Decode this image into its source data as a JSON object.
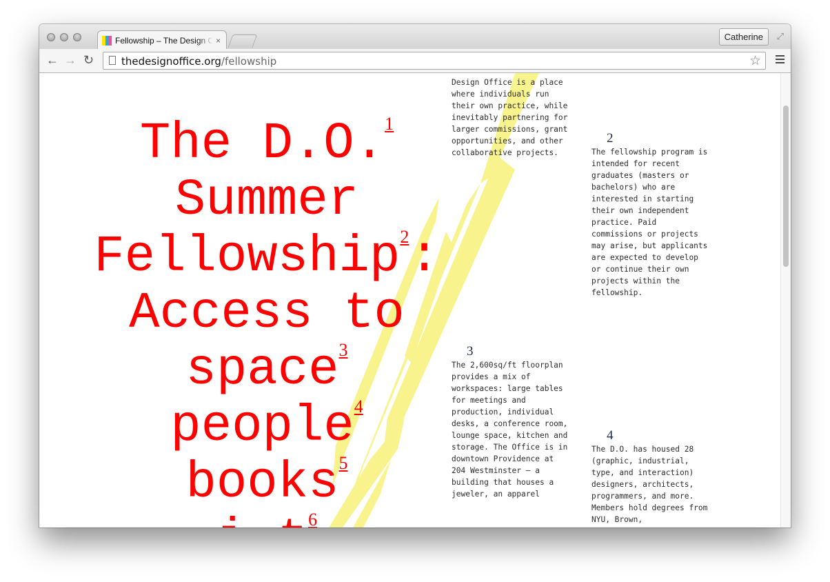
{
  "browser": {
    "tab_title": "Fellowship – The Design Office",
    "tab_close_glyph": "×",
    "profile_name": "Catherine",
    "url_host": "thedesignoffice.org",
    "url_path": "/fellowship",
    "favicon_colors": [
      "#ffe600",
      "#2aa8e0",
      "#f04e9a"
    ]
  },
  "page": {
    "headline": {
      "lines": [
        {
          "text": "The D.O.",
          "fn": "1",
          "after": ""
        },
        {
          "text": "Summer",
          "fn": "",
          "after": ""
        },
        {
          "text": "Fellowship",
          "fn": "2",
          "after": ":"
        },
        {
          "text": "Access to",
          "fn": "",
          "after": ""
        },
        {
          "text": "space",
          "fn": "3",
          "after": ""
        },
        {
          "text": "people",
          "fn": "4",
          "after": ""
        },
        {
          "text": "books",
          "fn": "5",
          "after": ""
        },
        {
          "text": "i  t",
          "fn": "6",
          "after": ""
        }
      ],
      "color": "#ff0000"
    },
    "notes": [
      {
        "num": "",
        "text": "Design Office is a place where individuals run their own practice, while inevitably partnering for larger commissions, grant opportunities, and other collaborative projects."
      },
      {
        "num": "2",
        "text": "The fellowship program is intended for recent graduates (masters or bachelors) who are interested in starting their own independent practice. Paid commissions or projects may arise, but applicants are expected to develop or continue their own projects within the fellowship."
      },
      {
        "num": "3",
        "text": "The 2,600sq/ft floorplan provides a mix of workspaces: large tables for meetings and production, individual desks, a conference room, lounge space, kitchen and storage. The Office is in downtown Providence at 204 Westminster – a building that houses a jeweler, an apparel"
      },
      {
        "num": "4",
        "text": "The D.O. has housed 28 (graphic, industrial, type, and interaction) designers, architects, programmers, and more. Members hold degrees from NYU, Brown,"
      }
    ],
    "swash_color": "#f7f27a"
  }
}
